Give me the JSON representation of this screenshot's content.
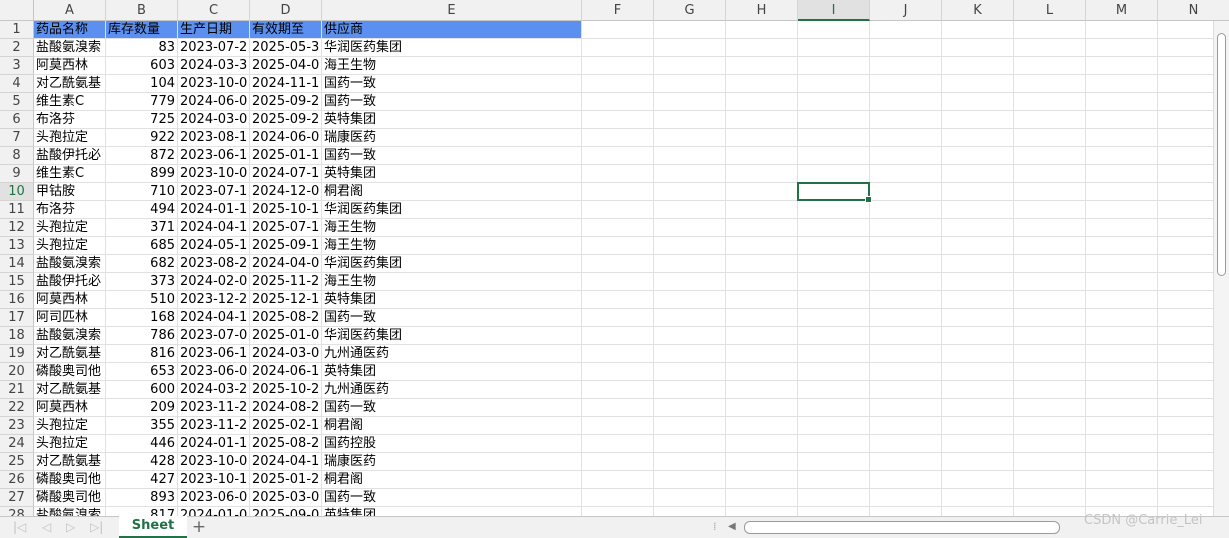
{
  "columns": [
    "A",
    "B",
    "C",
    "D",
    "E",
    "F",
    "G",
    "H",
    "I",
    "J",
    "K",
    "L",
    "M",
    "N"
  ],
  "selected_column": "I",
  "selected_row": 10,
  "headers": [
    "药品名称",
    "库存数量",
    "生产日期",
    "有效期至",
    "供应商"
  ],
  "header_fill": "#5b8ff0",
  "rows": [
    [
      "盐酸氨溴索",
      "83",
      "2023-07-2",
      "2025-05-3",
      "华润医药集团"
    ],
    [
      "阿莫西林",
      "603",
      "2024-03-3",
      "2025-04-0",
      "海王生物"
    ],
    [
      "对乙酰氨基",
      "104",
      "2023-10-0",
      "2024-11-1",
      "国药一致"
    ],
    [
      "维生素C",
      "779",
      "2024-06-0",
      "2025-09-2",
      "国药一致"
    ],
    [
      "布洛芬",
      "725",
      "2024-03-0",
      "2025-09-2",
      "英特集团"
    ],
    [
      "头孢拉定",
      "922",
      "2023-08-1",
      "2024-06-0",
      "瑞康医药"
    ],
    [
      "盐酸伊托必",
      "872",
      "2023-06-1",
      "2025-01-1",
      "国药一致"
    ],
    [
      "维生素C",
      "899",
      "2023-10-0",
      "2024-07-1",
      "英特集团"
    ],
    [
      "甲钴胺",
      "710",
      "2023-07-1",
      "2024-12-0",
      "桐君阁"
    ],
    [
      "布洛芬",
      "494",
      "2024-01-1",
      "2025-10-1",
      "华润医药集团"
    ],
    [
      "头孢拉定",
      "371",
      "2024-04-1",
      "2025-07-1",
      "海王生物"
    ],
    [
      "头孢拉定",
      "685",
      "2024-05-1",
      "2025-09-1",
      "海王生物"
    ],
    [
      "盐酸氨溴索",
      "682",
      "2023-08-2",
      "2024-04-0",
      "华润医药集团"
    ],
    [
      "盐酸伊托必",
      "373",
      "2024-02-0",
      "2025-11-2",
      "海王生物"
    ],
    [
      "阿莫西林",
      "510",
      "2023-12-2",
      "2025-12-1",
      "英特集团"
    ],
    [
      "阿司匹林",
      "168",
      "2024-04-1",
      "2025-08-2",
      "国药一致"
    ],
    [
      "盐酸氨溴索",
      "786",
      "2023-07-0",
      "2025-01-0",
      "华润医药集团"
    ],
    [
      "对乙酰氨基",
      "816",
      "2023-06-1",
      "2024-03-0",
      "九州通医药"
    ],
    [
      "磷酸奥司他",
      "653",
      "2023-06-0",
      "2024-06-1",
      "英特集团"
    ],
    [
      "对乙酰氨基",
      "600",
      "2024-03-2",
      "2025-10-2",
      "九州通医药"
    ],
    [
      "阿莫西林",
      "209",
      "2023-11-2",
      "2024-08-2",
      "国药一致"
    ],
    [
      "头孢拉定",
      "355",
      "2023-11-2",
      "2025-02-1",
      "桐君阁"
    ],
    [
      "头孢拉定",
      "446",
      "2024-01-1",
      "2025-08-2",
      "国药控股"
    ],
    [
      "对乙酰氨基",
      "428",
      "2023-10-0",
      "2024-04-1",
      "瑞康医药"
    ],
    [
      "磷酸奥司他",
      "427",
      "2023-10-1",
      "2025-01-2",
      "桐君阁"
    ],
    [
      "磷酸奥司他",
      "893",
      "2023-06-0",
      "2025-03-0",
      "国药一致"
    ],
    [
      "盐酸氨溴索",
      "817",
      "2024-01-0",
      "2025-09-0",
      "英特集团"
    ]
  ],
  "sheet_tab": "Sheet",
  "add_sheet": "+",
  "watermark": "CSDN @Carrie_Lei"
}
